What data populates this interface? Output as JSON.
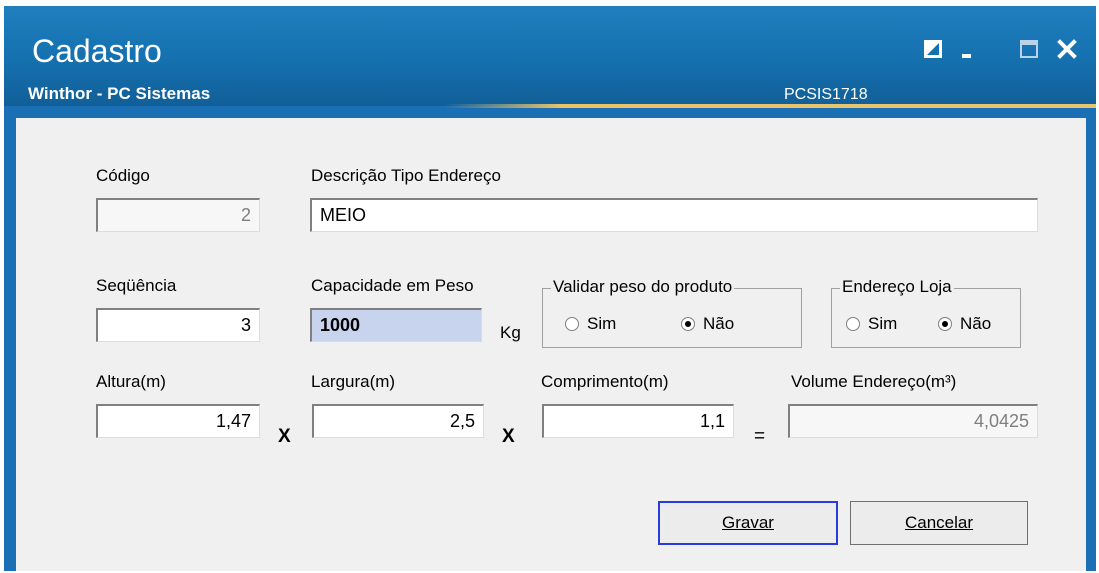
{
  "window": {
    "title": "Cadastro",
    "subtitle": "Winthor - PC Sistemas",
    "routine_code": "PCSIS1718",
    "icons": [
      "restore-icon",
      "minimize-icon",
      "maximize-icon",
      "close-icon"
    ]
  },
  "form": {
    "codigo": {
      "label": "Código",
      "value": "2"
    },
    "descricao": {
      "label": "Descrição Tipo Endereço",
      "value": "MEIO"
    },
    "sequencia": {
      "label": "Seqüência",
      "value": "3"
    },
    "capacidade": {
      "label": "Capacidade em Peso",
      "value": "1000",
      "unit": "Kg"
    },
    "validar_peso": {
      "legend": "Validar peso do produto",
      "options": [
        "Sim",
        "Não"
      ],
      "selected": "Não"
    },
    "endereco_loja": {
      "legend": "Endereço Loja",
      "options": [
        "Sim",
        "Não"
      ],
      "selected": "Não"
    },
    "altura": {
      "label": "Altura(m)",
      "value": "1,47"
    },
    "largura": {
      "label": "Largura(m)",
      "value": "2,5"
    },
    "comprimento": {
      "label": "Comprimento(m)",
      "value": "1,1"
    },
    "volume": {
      "label": "Volume Endereço(m³)",
      "value": "4,0425"
    },
    "ops": {
      "times": "X",
      "equals": "="
    }
  },
  "buttons": {
    "save": "Gravar",
    "cancel": "Cancelar"
  },
  "colors": {
    "titlebar": "#1570ae",
    "accent_line": "#e8c36a",
    "default_button_border": "#2a3bdc",
    "highlight_field": "#c8d4ee"
  }
}
